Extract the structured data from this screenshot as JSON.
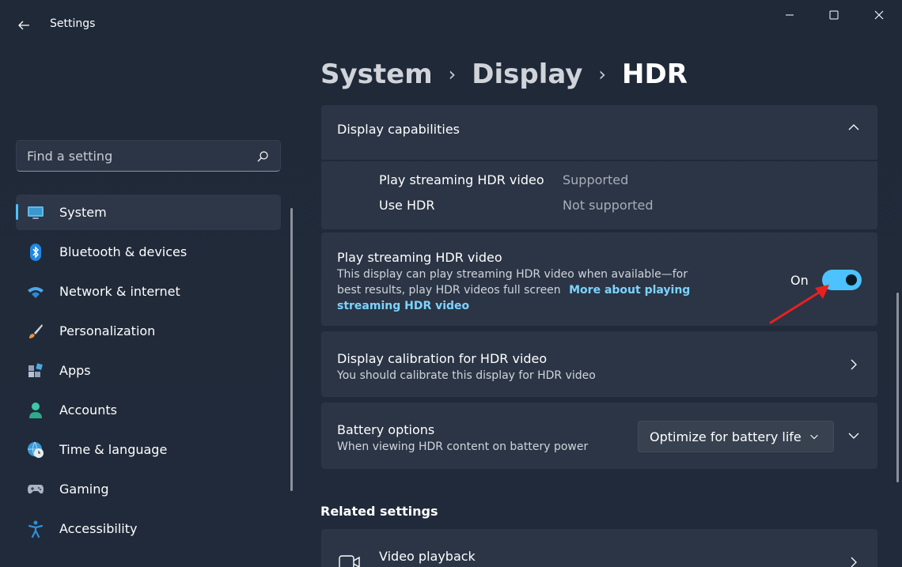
{
  "window": {
    "app_title": "Settings"
  },
  "search": {
    "placeholder": "Find a setting"
  },
  "sidebar": {
    "items": [
      {
        "label": "System",
        "icon": "monitor-icon",
        "active": true
      },
      {
        "label": "Bluetooth & devices",
        "icon": "bluetooth-icon"
      },
      {
        "label": "Network & internet",
        "icon": "wifi-icon"
      },
      {
        "label": "Personalization",
        "icon": "brush-icon"
      },
      {
        "label": "Apps",
        "icon": "apps-icon"
      },
      {
        "label": "Accounts",
        "icon": "person-icon"
      },
      {
        "label": "Time & language",
        "icon": "globe-clock-icon"
      },
      {
        "label": "Gaming",
        "icon": "gamepad-icon"
      },
      {
        "label": "Accessibility",
        "icon": "accessibility-icon"
      }
    ]
  },
  "breadcrumb": {
    "items": [
      "System",
      "Display",
      "HDR"
    ]
  },
  "capabilities": {
    "title": "Display capabilities",
    "rows": [
      {
        "label": "Play streaming HDR video",
        "value": "Supported"
      },
      {
        "label": "Use HDR",
        "value": "Not supported"
      }
    ]
  },
  "streaming": {
    "title": "Play streaming HDR video",
    "desc_line1": "This display can play streaming HDR video when available—for",
    "desc_line2": "best results, play HDR videos full screen",
    "link_part1": "More about playing",
    "link_part2": "streaming HDR video",
    "toggle_state": "On",
    "toggle_on": true
  },
  "calibration": {
    "title": "Display calibration for HDR video",
    "desc": "You should calibrate this display for HDR video"
  },
  "battery": {
    "title": "Battery options",
    "desc": "When viewing HDR content on battery power",
    "dropdown_value": "Optimize for battery life"
  },
  "related": {
    "title": "Related settings",
    "video_playback": "Video playback"
  },
  "colors": {
    "accent": "#4cc2ff",
    "annotation": "#e8201f",
    "background": "#202b3a",
    "card": "#2b3545"
  }
}
